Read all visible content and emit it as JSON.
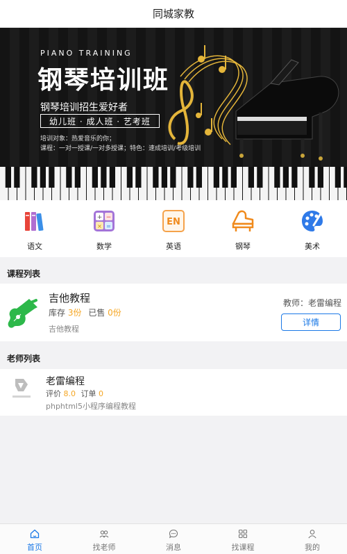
{
  "nav": {
    "title": "同城家教"
  },
  "banner": {
    "english_title": "PIANO TRAINING",
    "title": "钢琴培训班",
    "subtitle": "钢琴培训招生爱好者",
    "tag": "幼儿班 · 成人班 · 艺考班",
    "line1": "培训对象：热爱音乐的你；",
    "line2": "课程：一对一授课/一对多授课；特色：速成培训/考级培训"
  },
  "categories": [
    {
      "label": "语文",
      "icon": "books-icon"
    },
    {
      "label": "数学",
      "icon": "calculator-icon"
    },
    {
      "label": "英语",
      "icon": "en-icon"
    },
    {
      "label": "钢琴",
      "icon": "piano-icon"
    },
    {
      "label": "美术",
      "icon": "palette-icon"
    }
  ],
  "course_section": {
    "title": "课程列表"
  },
  "course": {
    "name": "吉他教程",
    "stock_label": "库存",
    "stock_value": "3份",
    "sold_label": "已售",
    "sold_value": "0份",
    "desc": "吉他教程",
    "teacher": "教师：老雷编程",
    "button": "详情",
    "icon": "guitar-icon"
  },
  "teacher_section": {
    "title": "老师列表"
  },
  "teacher": {
    "name": "老雷编程",
    "rating_label": "评价",
    "rating_value": "8.0",
    "orders_label": "订单",
    "orders_value": "0",
    "desc": "phphtml5小程序编程教程"
  },
  "tabs": [
    {
      "label": "首页",
      "icon": "home-icon",
      "active": true
    },
    {
      "label": "找老师",
      "icon": "teachers-icon",
      "active": false
    },
    {
      "label": "消息",
      "icon": "message-icon",
      "active": false
    },
    {
      "label": "找课程",
      "icon": "grid-icon",
      "active": false
    },
    {
      "label": "我的",
      "icon": "user-icon",
      "active": false
    }
  ],
  "colors": {
    "accent": "#1a78e6",
    "highlight": "#f5a623",
    "guitar": "#2db84a"
  }
}
